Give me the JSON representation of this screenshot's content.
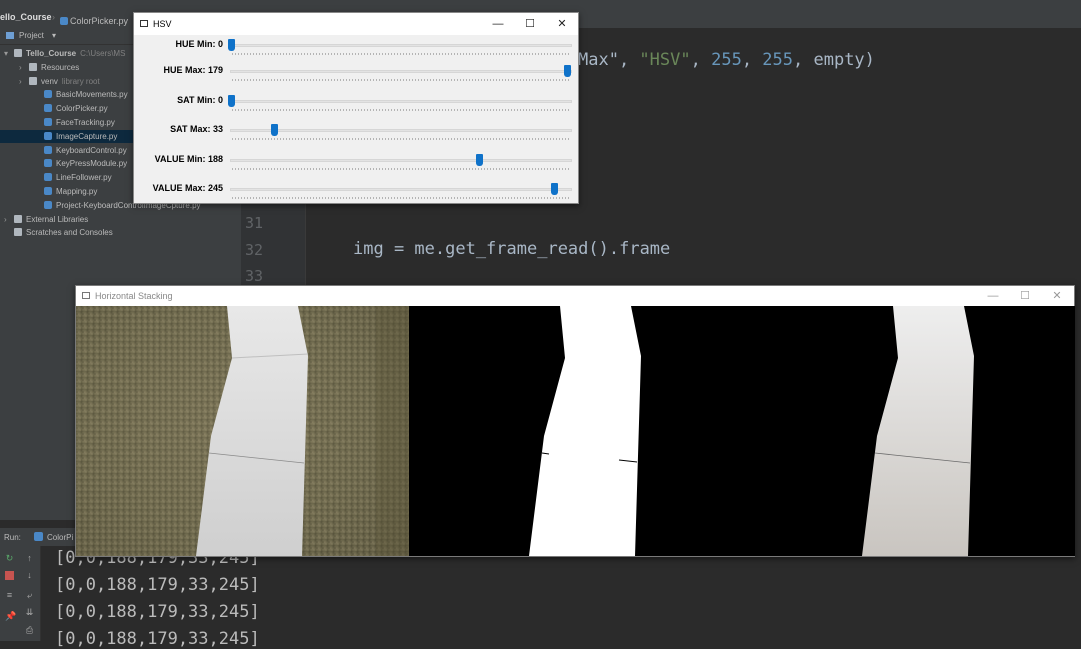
{
  "ide": {
    "breadcrumb_project": "ello_Course",
    "breadcrumb_file": "ColorPicker.py",
    "project_label": "Project",
    "tree": [
      {
        "label": "Tello_Course",
        "extra": "C:\\Users\\MS",
        "type": "folder",
        "indent": 0,
        "arrow": "▾"
      },
      {
        "label": "Resources",
        "extra": "",
        "type": "folder",
        "indent": 1,
        "arrow": "›"
      },
      {
        "label": "venv",
        "extra": "library root",
        "type": "folder",
        "indent": 1,
        "arrow": "›"
      },
      {
        "label": "BasicMovements.py",
        "extra": "",
        "type": "py",
        "indent": 2,
        "arrow": ""
      },
      {
        "label": "ColorPicker.py",
        "extra": "",
        "type": "py",
        "indent": 2,
        "arrow": ""
      },
      {
        "label": "FaceTracking.py",
        "extra": "",
        "type": "py",
        "indent": 2,
        "arrow": ""
      },
      {
        "label": "ImageCapture.py",
        "extra": "",
        "type": "py",
        "indent": 2,
        "arrow": "",
        "selected": true
      },
      {
        "label": "KeyboardControl.py",
        "extra": "",
        "type": "py",
        "indent": 2,
        "arrow": ""
      },
      {
        "label": "KeyPressModule.py",
        "extra": "",
        "type": "py",
        "indent": 2,
        "arrow": ""
      },
      {
        "label": "LineFollower.py",
        "extra": "",
        "type": "py",
        "indent": 2,
        "arrow": ""
      },
      {
        "label": "Mapping.py",
        "extra": "",
        "type": "py",
        "indent": 2,
        "arrow": ""
      },
      {
        "label": "Project-KeyboardControlImageCpture.py",
        "extra": "",
        "type": "py",
        "indent": 2,
        "arrow": ""
      },
      {
        "label": "External Libraries",
        "extra": "",
        "type": "lib",
        "indent": 0,
        "arrow": "›"
      },
      {
        "label": "Scratches and Consoles",
        "extra": "",
        "type": "scratch",
        "indent": 0,
        "arrow": ""
      }
    ],
    "code_partial": {
      "p1": "Max\", ",
      "s1": "\"HSV\"",
      "p2": ", ",
      "n1": "255",
      "p3": ", ",
      "n2": "255",
      "p4": ", empty)"
    },
    "line_numbers": [
      "31",
      "32",
      "33"
    ],
    "code_line_32": "img = me.get_frame_read().frame",
    "run_label": "Run:",
    "run_tab": "ColorPi",
    "output_lines": [
      "[0,0,188,179,33,245]",
      "[0,0,188,179,33,245]",
      "[0,0,188,179,33,245]",
      "[0,0,188,179,33,245]"
    ]
  },
  "hsv_window": {
    "title": "HSV",
    "controls": {
      "minimize": "—",
      "maximize": "☐",
      "close": "✕"
    },
    "trackbars": [
      {
        "label": "HUE Min: 0",
        "value": 0,
        "max": 179
      },
      {
        "label": "HUE Max: 179",
        "value": 179,
        "max": 179
      },
      {
        "label": "SAT Min: 0",
        "value": 0,
        "max": 255
      },
      {
        "label": "SAT Max: 33",
        "value": 33,
        "max": 255
      },
      {
        "label": "VALUE Min: 188",
        "value": 188,
        "max": 255
      },
      {
        "label": "VALUE Max: 245",
        "value": 245,
        "max": 255
      }
    ]
  },
  "stack_window": {
    "title": "Horizontal Stacking",
    "controls": {
      "minimize": "—",
      "maximize": "☐",
      "close": "✕"
    },
    "panels": [
      "original-camera-frame",
      "binary-mask",
      "masked-result"
    ]
  },
  "colors": {
    "accent": "#0f72c9",
    "ide_bg": "#2b2b2b",
    "panel_bg": "#3c3f41",
    "string": "#6a8759",
    "number": "#6897bb"
  }
}
